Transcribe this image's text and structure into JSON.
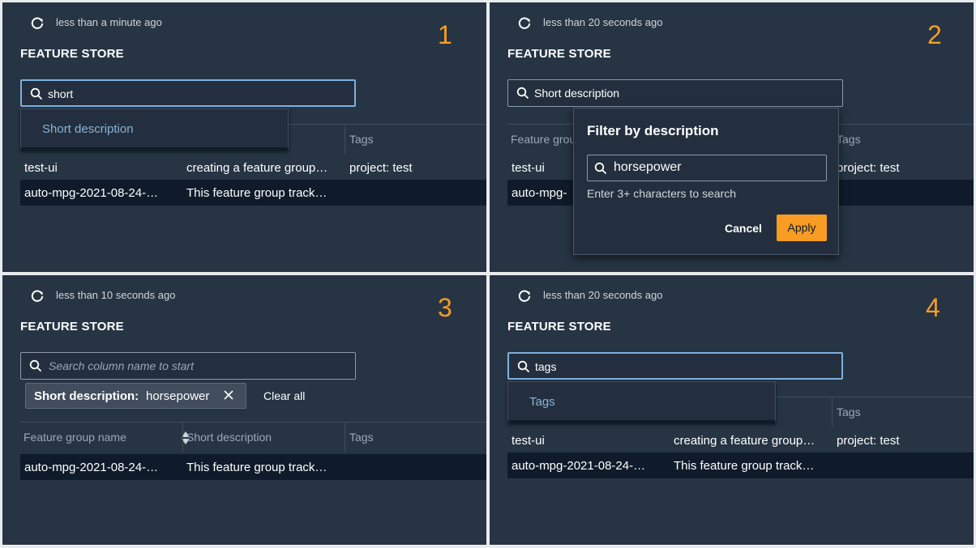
{
  "colors": {
    "panel_bg": "#263444",
    "accent": "#f89c24",
    "link": "#89b3d8",
    "row_selected": "#0f1b2a"
  },
  "icons": {
    "refresh": "refresh-icon",
    "search": "search-icon",
    "close": "close-icon",
    "sort": "sort-icon"
  },
  "panels": [
    {
      "step": "1",
      "refresh_text": "less than a minute ago",
      "title": "FEATURE STORE",
      "search_value": "short",
      "dropdown_option": "Short description",
      "columns": [
        "Tags"
      ],
      "rows": [
        [
          "test-ui",
          "creating a feature group…",
          "project: test"
        ],
        [
          "auto-mpg-2021-08-24-…",
          "This feature group track…",
          ""
        ]
      ]
    },
    {
      "step": "2",
      "refresh_text": "less than 20 seconds ago",
      "title": "FEATURE STORE",
      "search_value": "Short description",
      "columns": [
        "Feature grou",
        "Tags"
      ],
      "rows": [
        [
          "test-ui",
          "project: test"
        ],
        [
          "auto-mpg-"
        ]
      ],
      "popover": {
        "title": "Filter by description",
        "input_value": "horsepower",
        "hint": "Enter 3+ characters to search",
        "cancel": "Cancel",
        "apply": "Apply"
      }
    },
    {
      "step": "3",
      "refresh_text": "less than 10 seconds ago",
      "title": "FEATURE STORE",
      "search_placeholder": "Search column name to start",
      "chip_key": "Short description:",
      "chip_value": "horsepower",
      "clear_all": "Clear all",
      "columns": [
        "Feature group name",
        "Short description",
        "Tags"
      ],
      "rows": [
        [
          "auto-mpg-2021-08-24-…",
          "This feature group track…",
          ""
        ]
      ]
    },
    {
      "step": "4",
      "refresh_text": "less than 20 seconds ago",
      "title": "FEATURE STORE",
      "search_value": "tags",
      "dropdown_option": "Tags",
      "columns": [
        "Tags"
      ],
      "rows": [
        [
          "test-ui",
          "creating a feature group…",
          "project: test"
        ],
        [
          "auto-mpg-2021-08-24-…",
          "This feature group track…",
          ""
        ]
      ]
    }
  ]
}
